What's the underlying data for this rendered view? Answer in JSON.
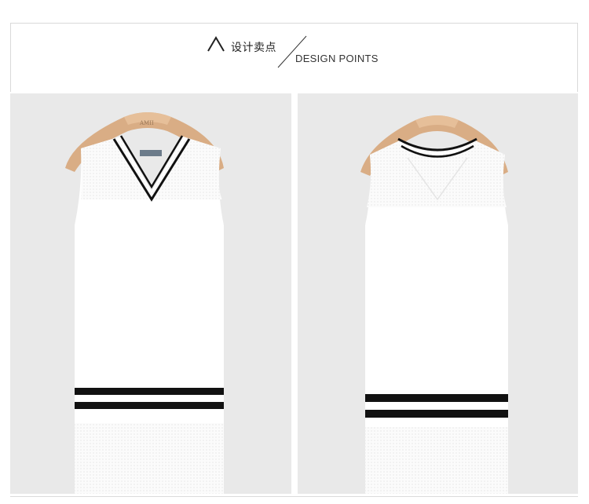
{
  "header": {
    "title_cn": "设计卖点",
    "title_en": "DESIGN POINTS"
  },
  "photos": [
    {
      "view": "front",
      "hanger_brand": "AMII",
      "hanger_color": "#d9ad85",
      "garment_color": "#ffffff",
      "stripe_color": "#111111",
      "background": "#e9e9e9"
    },
    {
      "view": "back",
      "hanger_color": "#d9ad85",
      "garment_color": "#ffffff",
      "stripe_color": "#111111",
      "background": "#e9e9e9"
    }
  ]
}
